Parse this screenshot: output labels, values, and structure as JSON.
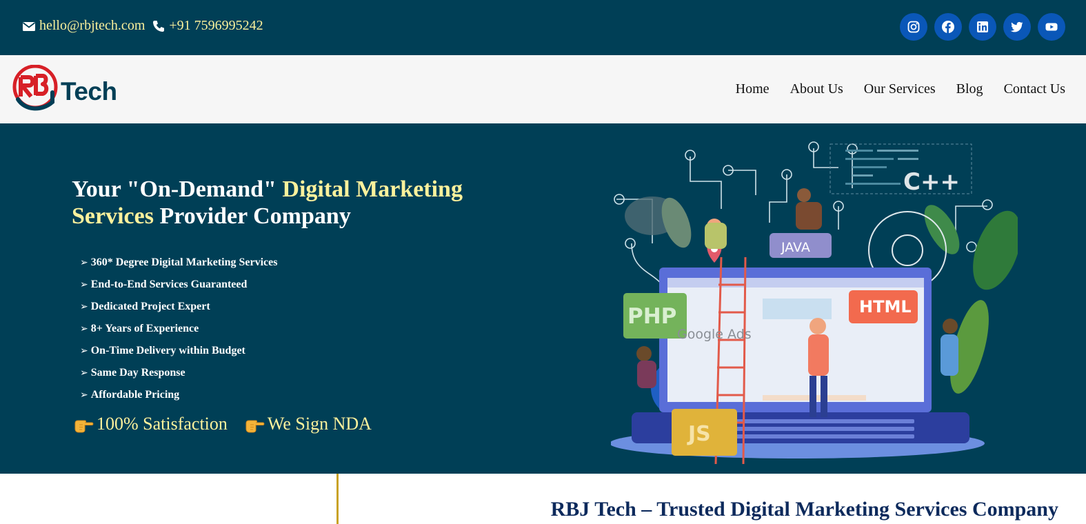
{
  "topbar": {
    "email": "hello@rbjtech.com",
    "phone": "+91 7596995242",
    "email_icon": "envelope-icon",
    "phone_icon": "phone-icon",
    "socials": [
      "instagram-icon",
      "facebook-icon",
      "linkedin-icon",
      "twitter-icon",
      "youtube-icon"
    ]
  },
  "brand": {
    "logo_text": "Tech"
  },
  "nav": {
    "items": [
      {
        "label": "Home"
      },
      {
        "label": "About Us"
      },
      {
        "label": "Our Services"
      },
      {
        "label": "Blog"
      },
      {
        "label": "Contact Us"
      }
    ]
  },
  "hero": {
    "headline_part1": "Your \"On-Demand\" ",
    "headline_highlight": "Digital Marketing Services",
    "headline_part2": " Provider Company",
    "features": [
      "360* Degree Digital Marketing Services",
      "End-to-End Services Guaranteed",
      "Dedicated Project Expert",
      "8+ Years of Experience",
      "On-Time Delivery within Budget",
      "Same Day Response",
      "Affordable Pricing"
    ],
    "feature_arrow": "➢",
    "promises": [
      "100% Satisfaction",
      "We Sign NDA"
    ],
    "illustration_labels": {
      "cpp": "C++",
      "java": "JAVA",
      "php": "PHP",
      "html": "HTML",
      "google_ads": "Google Ads",
      "js": "JS"
    }
  },
  "section": {
    "title": "RBJ Tech – Trusted Digital Marketing Services Company"
  },
  "colors": {
    "dark_teal": "#003f56",
    "accent_yellow": "#fcf19c",
    "social_blue": "#0a57b8",
    "logo_red": "#d72027",
    "nav_bg": "#f6f6f6",
    "section_title": "#0d2a5c"
  }
}
